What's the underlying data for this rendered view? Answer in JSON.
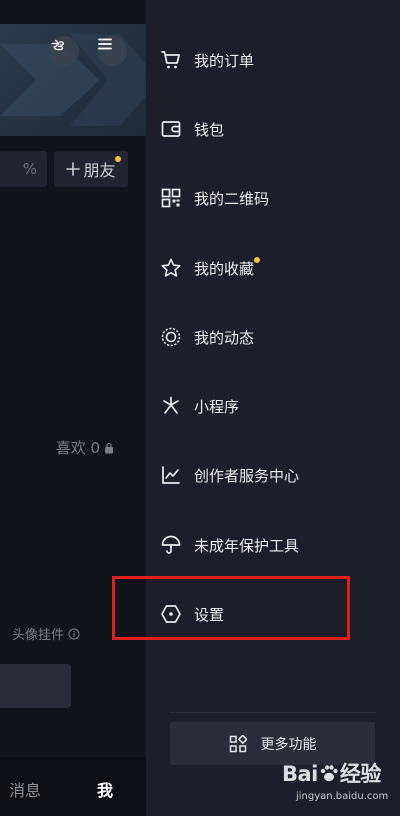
{
  "profile_page": {
    "friend_field_stub": "%",
    "add_friend_label": "朋友",
    "likes_label": "喜欢 0",
    "pendant_label": "头像挂件",
    "bottom_tabs": [
      {
        "label": "消息",
        "active": false
      },
      {
        "label": "我",
        "active": true
      }
    ]
  },
  "drawer": {
    "menu_items": [
      {
        "label": "我的订单",
        "icon": "cart-icon",
        "badge": false
      },
      {
        "label": "钱包",
        "icon": "wallet-icon",
        "badge": false
      },
      {
        "label": "我的二维码",
        "icon": "qr-code-icon",
        "badge": false
      },
      {
        "label": "我的收藏",
        "icon": "star-icon",
        "badge": true
      },
      {
        "label": "我的动态",
        "icon": "moments-icon",
        "badge": false
      },
      {
        "label": "小程序",
        "icon": "mini-program-icon",
        "badge": false
      },
      {
        "label": "创作者服务中心",
        "icon": "chart-line-icon",
        "badge": false
      },
      {
        "label": "未成年保护工具",
        "icon": "umbrella-icon",
        "badge": false
      },
      {
        "label": "设置",
        "icon": "settings-hexagon-icon",
        "badge": false
      }
    ],
    "more_label": "更多功能"
  },
  "watermark": {
    "brand": "Bai",
    "brand_suffix": "经验",
    "url": "jingyan.baidu.com"
  },
  "colors": {
    "drawer_bg": "#1c1f29",
    "page_bg": "#12141c",
    "highlight": "#e0201d",
    "badge": "#f5c242"
  }
}
